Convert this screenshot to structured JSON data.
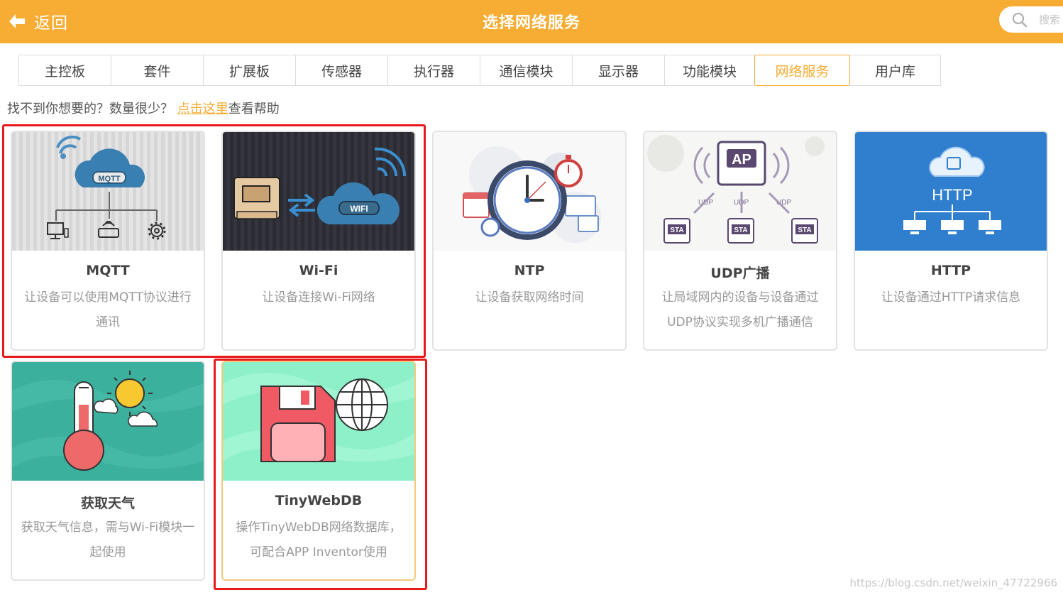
{
  "header": {
    "back_label": "返回",
    "title": "选择网络服务",
    "search_placeholder": "搜索",
    "bg_color": "#f7ac33"
  },
  "tabs": [
    {
      "label": "主控板"
    },
    {
      "label": "套件"
    },
    {
      "label": "扩展板"
    },
    {
      "label": "传感器"
    },
    {
      "label": "执行器"
    },
    {
      "label": "通信模块"
    },
    {
      "label": "显示器"
    },
    {
      "label": "功能模块"
    },
    {
      "label": "网络服务",
      "active": true
    },
    {
      "label": "用户库"
    }
  ],
  "help": {
    "prefix": "找不到你想要的？数量很少？",
    "link": "点击这里",
    "suffix": "查看帮助"
  },
  "cards": [
    {
      "name": "MQTT",
      "desc": "让设备可以使用MQTT协议进行通讯",
      "icon": "mqtt-cloud-icon",
      "img_label": "MQTT"
    },
    {
      "name": "Wi-Fi",
      "desc": "让设备连接Wi-Fi网络",
      "icon": "wifi-cloud-icon",
      "img_label": "WIFI"
    },
    {
      "name": "NTP",
      "desc": "让设备获取网络时间",
      "icon": "clock-icon"
    },
    {
      "name": "UDP广播",
      "desc": "让局域网内的设备与设备通过UDP协议实现多机广播通信",
      "icon": "udp-broadcast-icon",
      "img_label": "AP",
      "sta_label": "STA",
      "udp_label": "UDP"
    },
    {
      "name": "HTTP",
      "desc": "让设备通过HTTP请求信息",
      "icon": "http-cloud-icon",
      "img_label": "HTTP"
    },
    {
      "name": "获取天气",
      "desc": "获取天气信息，需与Wi-Fi模块一起使用",
      "icon": "weather-thermometer-icon"
    },
    {
      "name": "TinyWebDB",
      "desc": "操作TinyWebDB网络数据库，可配合APP Inventor使用",
      "icon": "database-floppy-icon",
      "selected": true
    }
  ],
  "watermark": "https://blog.csdn.net/weixin_47722966",
  "colors": {
    "accent": "#f7ac33",
    "highlight": "#e8191a"
  }
}
